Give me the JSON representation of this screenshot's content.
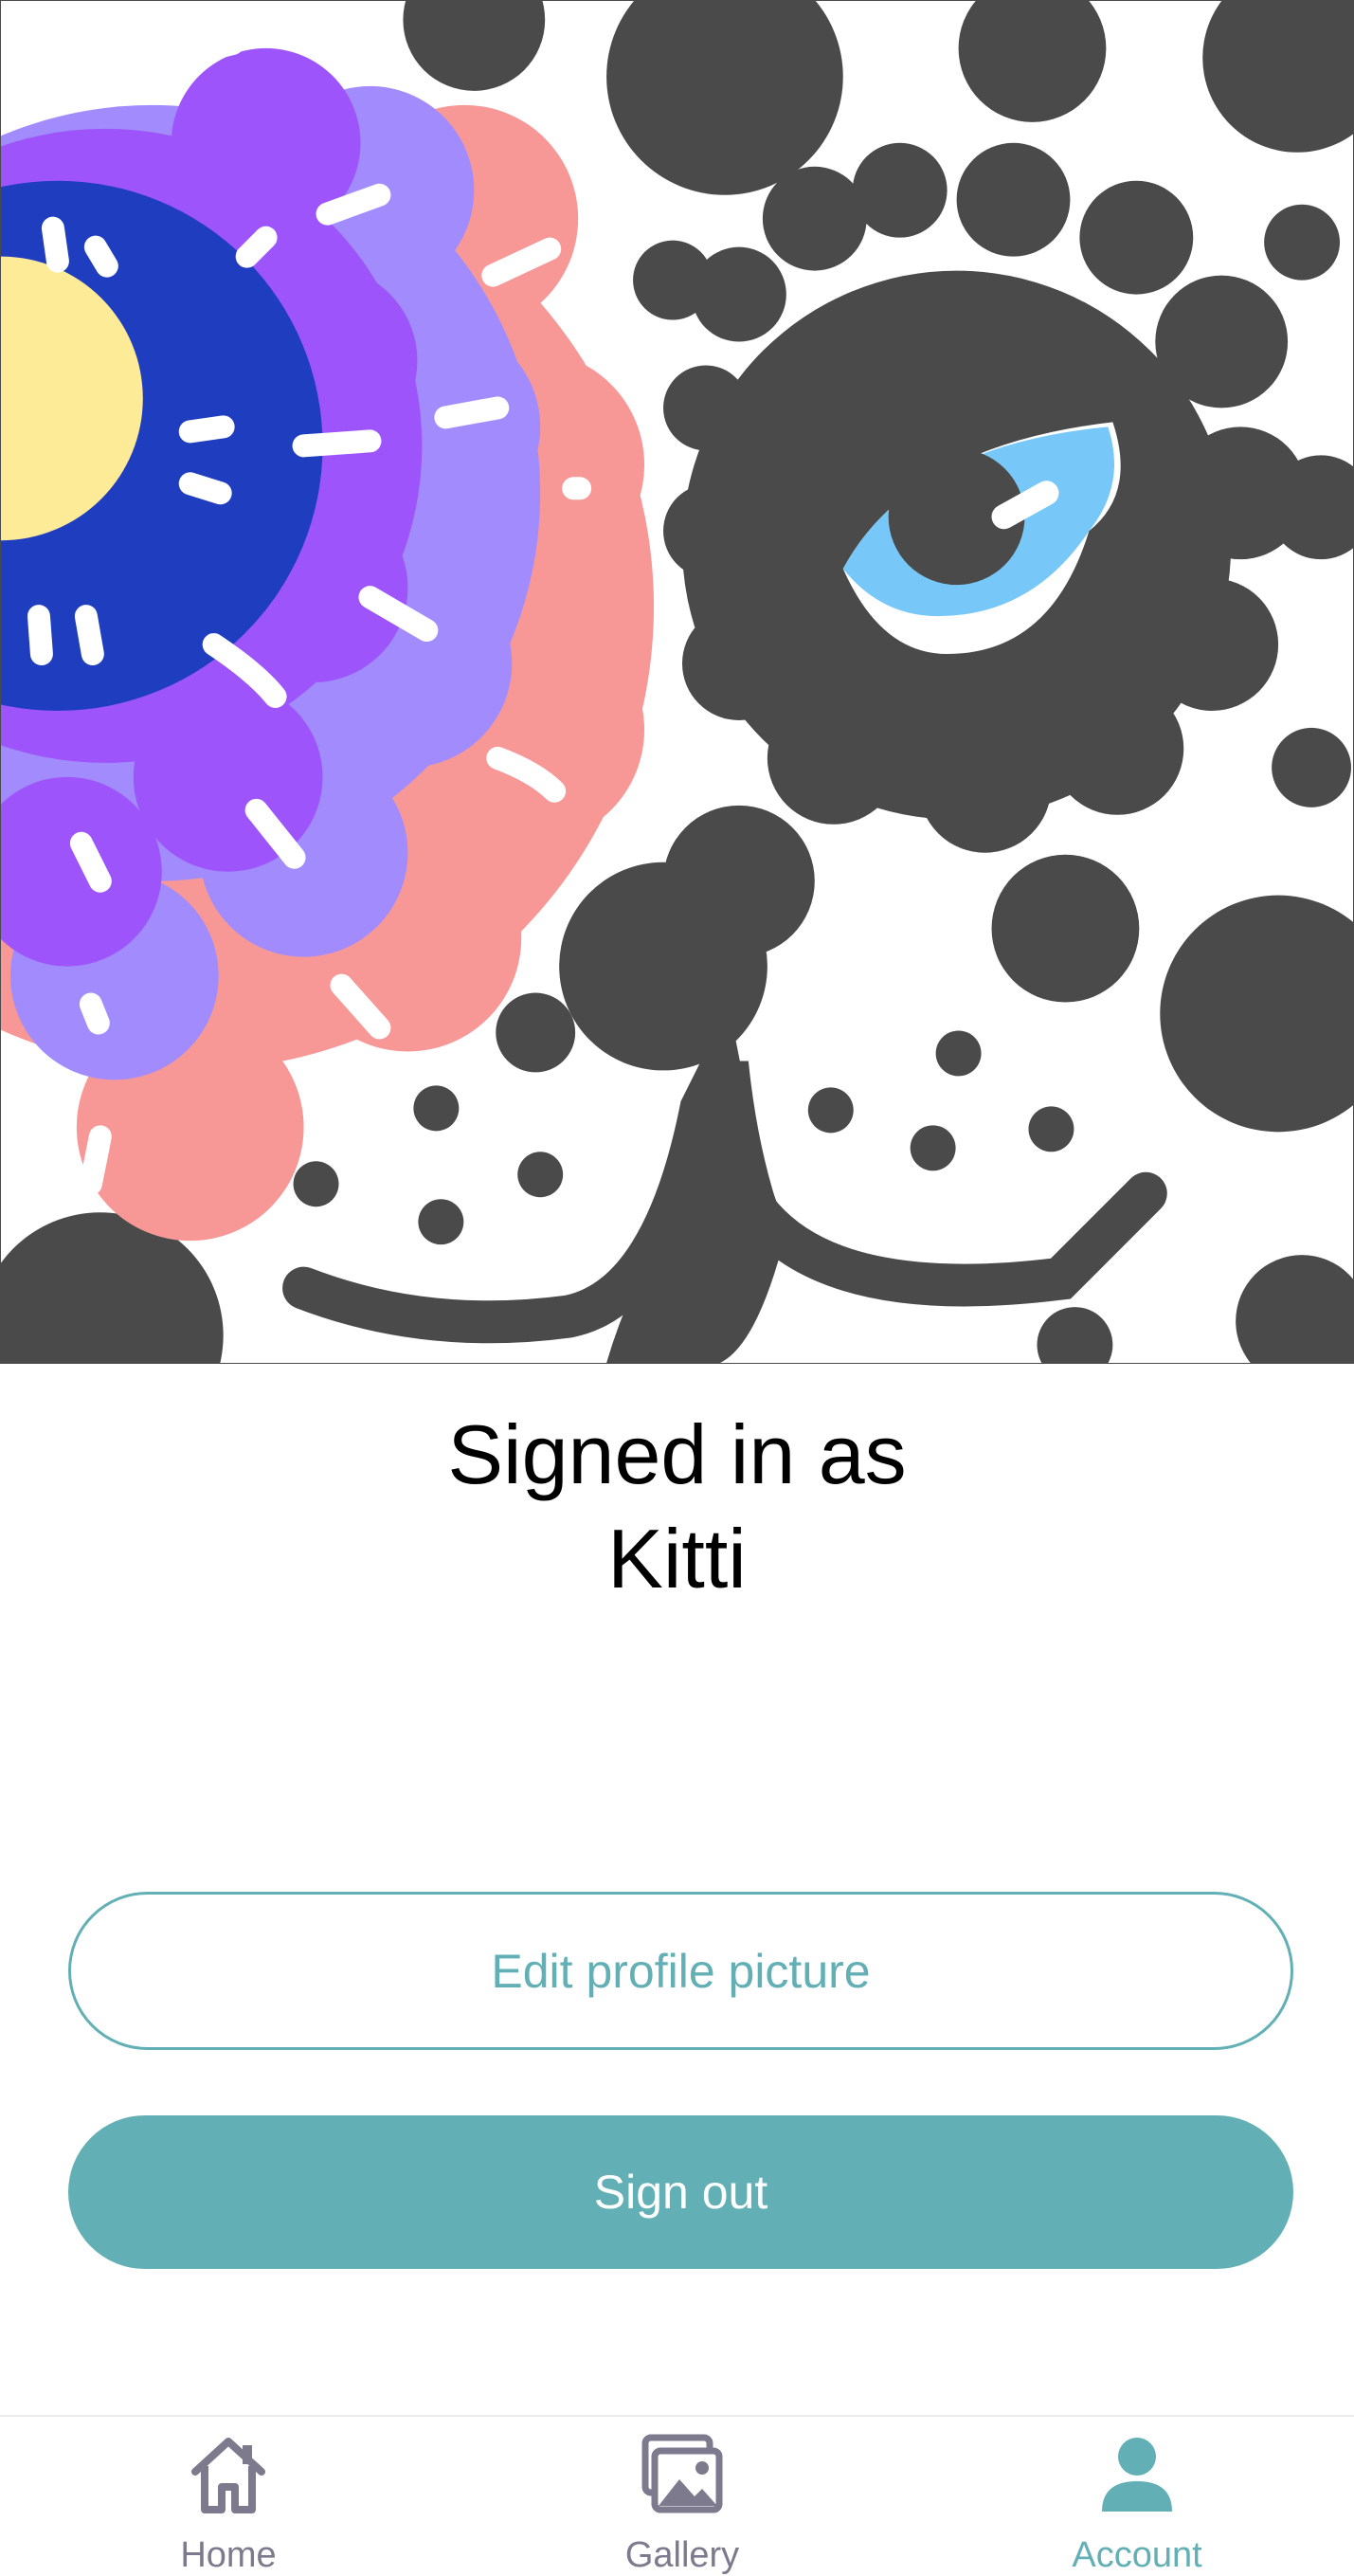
{
  "profile": {
    "image_description_icon": "profile-artwork"
  },
  "heading": {
    "line1": "Signed in as",
    "line2": "Kitti"
  },
  "actions": {
    "edit_profile_picture": "Edit profile picture",
    "sign_out": "Sign out"
  },
  "nav": {
    "items": [
      {
        "label": "Home",
        "icon": "home-icon",
        "active": false
      },
      {
        "label": "Gallery",
        "icon": "gallery-icon",
        "active": false
      },
      {
        "label": "Account",
        "icon": "account-icon",
        "active": true
      }
    ]
  },
  "colors": {
    "accent": "#62b0b5",
    "inactive": "#7c7a8c"
  }
}
